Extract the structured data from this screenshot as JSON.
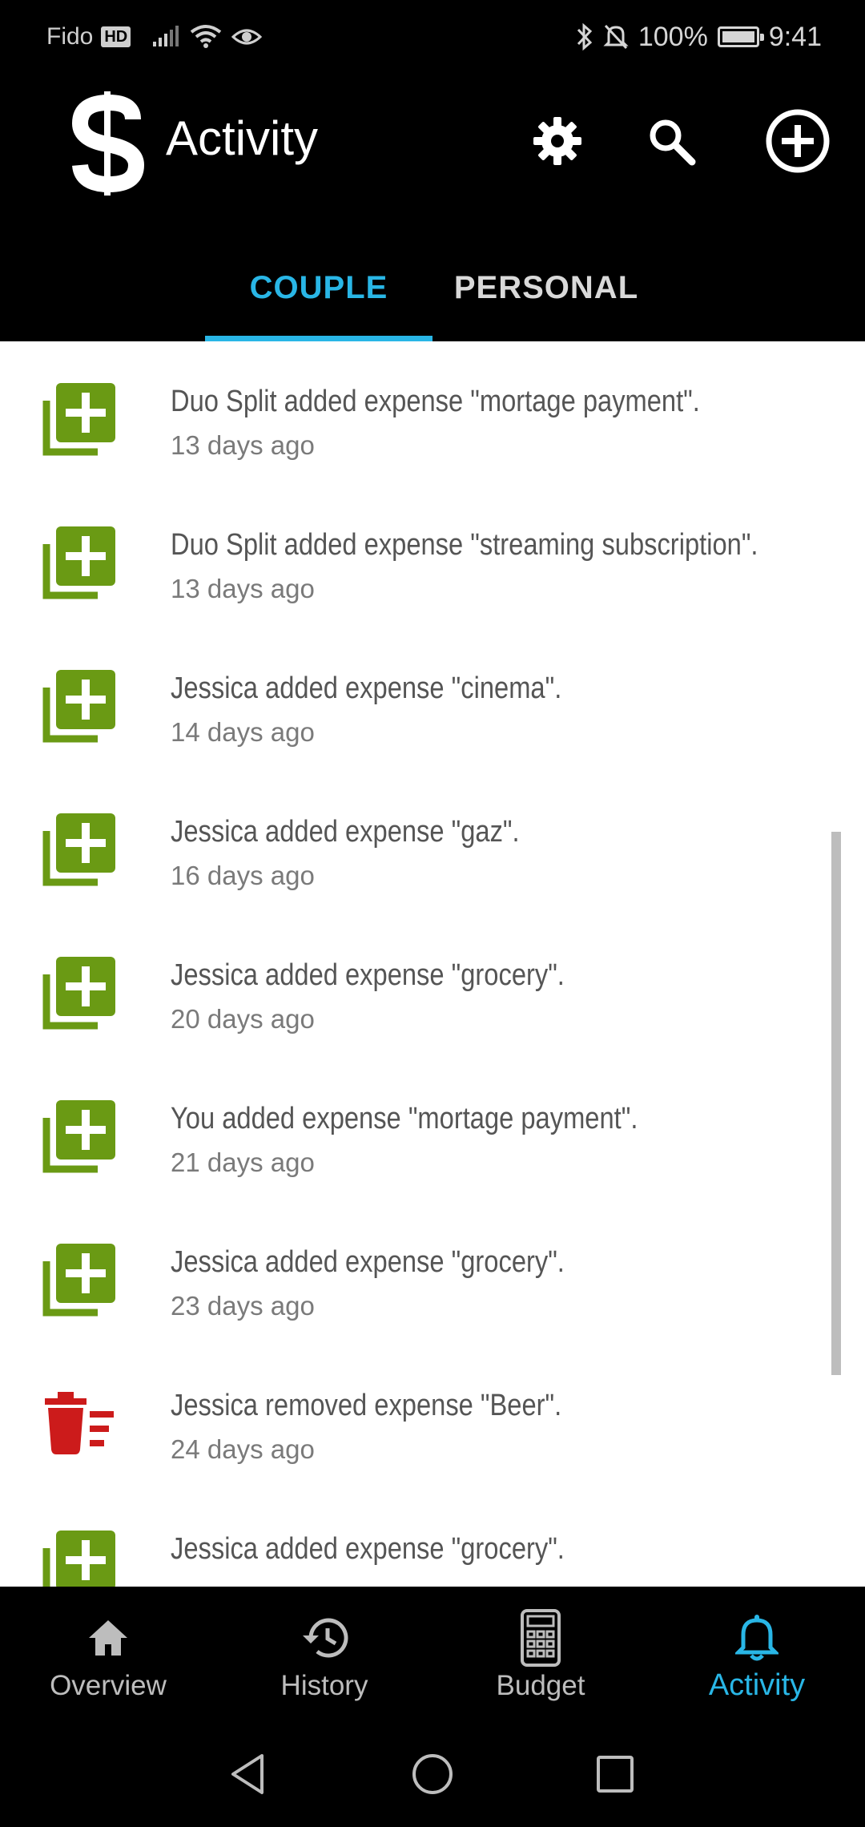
{
  "status_bar": {
    "carrier": "Fido",
    "network_badge": "HD",
    "battery": "100%",
    "time": "9:41",
    "icons": [
      "signal-icon",
      "wifi-icon",
      "eye-icon",
      "bluetooth-icon",
      "muted-bell-icon",
      "battery-icon"
    ]
  },
  "app_bar": {
    "title": "Activity",
    "actions": [
      "settings-icon",
      "search-icon",
      "add-circle-icon"
    ]
  },
  "tabs": [
    {
      "label": "COUPLE",
      "active": true
    },
    {
      "label": "PERSONAL",
      "active": false
    }
  ],
  "activity": [
    {
      "icon": "add-expense-icon",
      "text": "Duo Split added expense \"mortage payment\".",
      "time": "13 days ago"
    },
    {
      "icon": "add-expense-icon",
      "text": "Duo Split added expense \"streaming subscription\".",
      "time": "13 days ago"
    },
    {
      "icon": "add-expense-icon",
      "text": "Jessica added expense \"cinema\".",
      "time": "14 days ago"
    },
    {
      "icon": "add-expense-icon",
      "text": "Jessica added expense \"gaz\".",
      "time": "16 days ago"
    },
    {
      "icon": "add-expense-icon",
      "text": "Jessica added expense \"grocery\".",
      "time": "20 days ago"
    },
    {
      "icon": "add-expense-icon",
      "text": "You added expense \"mortage payment\".",
      "time": "21 days ago"
    },
    {
      "icon": "add-expense-icon",
      "text": "Jessica added expense \"grocery\".",
      "time": "23 days ago"
    },
    {
      "icon": "remove-expense-icon",
      "text": "Jessica removed expense \"Beer\".",
      "time": "24 days ago"
    },
    {
      "icon": "add-expense-icon",
      "text": "Jessica added expense \"grocery\".",
      "time": ""
    }
  ],
  "bottom_nav": [
    {
      "label": "Overview",
      "icon": "home-icon",
      "active": false
    },
    {
      "label": "History",
      "icon": "history-icon",
      "active": false
    },
    {
      "label": "Budget",
      "icon": "calculator-icon",
      "active": false
    },
    {
      "label": "Activity",
      "icon": "bell-icon",
      "active": true
    }
  ],
  "colors": {
    "accent": "#29b6e6",
    "add_green": "#6a9a14",
    "remove_red": "#cc1b1b"
  }
}
